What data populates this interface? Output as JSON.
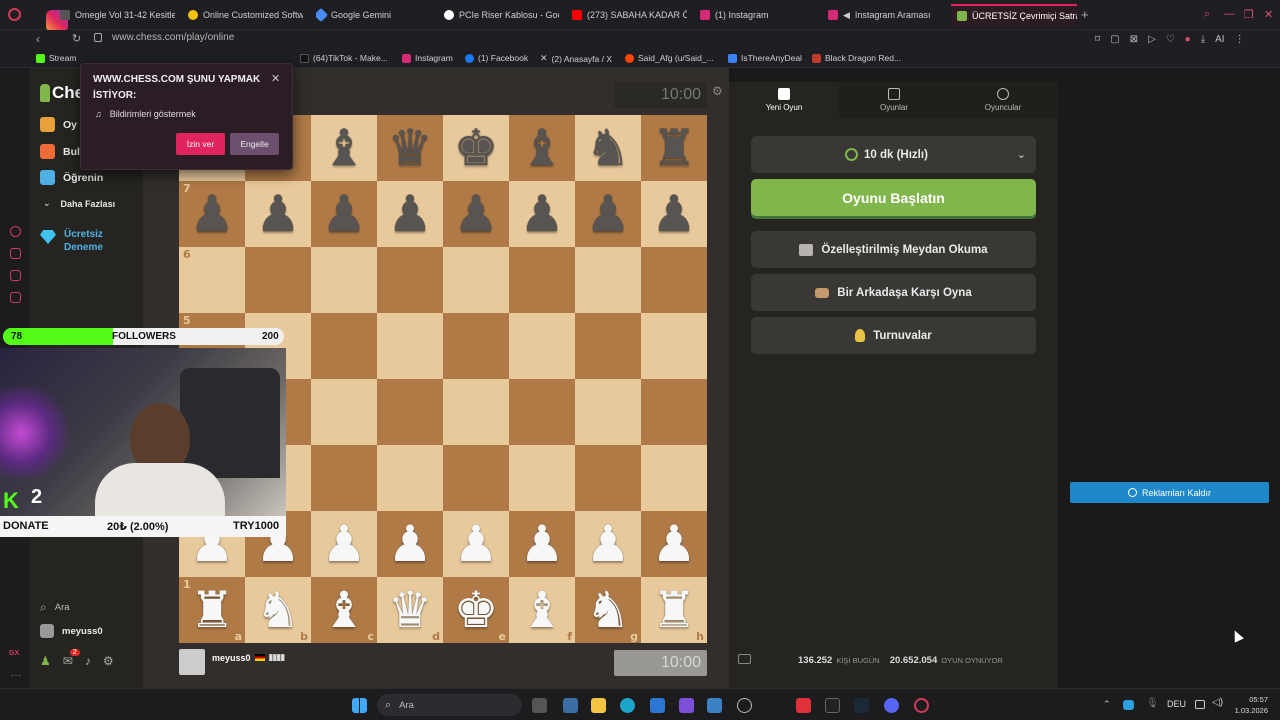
{
  "browser": {
    "tabs": [
      {
        "label": "Omegle Vol 31-42 Kesitler",
        "color": "#555"
      },
      {
        "label": "Online Customized Softwa",
        "color": "#f4c20d"
      },
      {
        "label": "Google Gemini",
        "color": "#4a8cf7"
      },
      {
        "label": "PCIe Riser Kablosu - Goog",
        "color": "#ffffff"
      },
      {
        "label": "(273) SABAHA KADAR ÖV",
        "color": "#ff0000"
      },
      {
        "label": "(1) Instagram",
        "color": "#d62976"
      },
      {
        "label": "Instagram Araması",
        "color": "#d62976"
      },
      {
        "label": "ÜCRETSİZ Çevrimiçi Satra",
        "color": "#81b64c"
      }
    ],
    "url": "www.chess.com/play/online",
    "bookmarks": [
      {
        "label": "Stream",
        "color": "#53fc18"
      },
      {
        "label": "(64)TikTok - Make...",
        "color": "#111"
      },
      {
        "label": "Instagram",
        "color": "#d62976"
      },
      {
        "label": "(1) Facebook",
        "color": "#1877f2"
      },
      {
        "label": "(2) Anasayfa / X",
        "color": "#000"
      },
      {
        "label": "Said_Afg (u/Said_...",
        "color": "#ff4500"
      },
      {
        "label": "IsThereAnyDeal",
        "color": "#3b82f6"
      },
      {
        "label": "Black Dragon Red...",
        "color": "#c0392b"
      }
    ]
  },
  "permission_popup": {
    "title": "WWW.CHESS.COM ŞUNU YAPMAK İSTİYOR:",
    "item": "Bildirimleri göstermek",
    "allow_label": "İzin ver",
    "block_label": "Engelle"
  },
  "sidebar": {
    "logo": "Ches",
    "items": [
      {
        "label": "Oy",
        "color": "#e9a23b"
      },
      {
        "label": "Bul",
        "color": "#ef6b3a"
      },
      {
        "label": "Öğrenin",
        "color": "#4fb0e6"
      }
    ],
    "more_label": "Daha Fazlası",
    "trial_label_1": "Ücretsiz",
    "trial_label_2": "Deneme",
    "search_label": "Ara",
    "user_label": "meyuss0",
    "notification_count": "2"
  },
  "board": {
    "top_clock": "10:00",
    "bottom_clock": "10:00",
    "player_name": "meyuss0",
    "ranks_labels": [
      "7",
      "6",
      "5",
      "1"
    ],
    "files_labels": [
      "a",
      "b",
      "c",
      "d",
      "e",
      "f",
      "g",
      "h"
    ],
    "position": [
      [
        "♜",
        "♞",
        "♝",
        "♛",
        "♚",
        "♝",
        "♞",
        "♜"
      ],
      [
        "♟",
        "♟",
        "♟",
        "♟",
        "♟",
        "♟",
        "♟",
        "♟"
      ],
      [
        "",
        "",
        "",
        "",
        "",
        "",
        "",
        ""
      ],
      [
        "",
        "",
        "",
        "",
        "",
        "",
        "",
        ""
      ],
      [
        "",
        "",
        "",
        "",
        "",
        "",
        "",
        ""
      ],
      [
        "",
        "",
        "",
        "",
        "",
        "",
        "",
        ""
      ],
      [
        "♟",
        "♟",
        "♟",
        "♟",
        "♟",
        "♟",
        "♟",
        "♟"
      ],
      [
        "♜",
        "♞",
        "♝",
        "♛",
        "♚",
        "♝",
        "♞",
        "♜"
      ]
    ]
  },
  "panel": {
    "tabs": [
      "Yeni Oyun",
      "Oyunlar",
      "Oyuncular"
    ],
    "time_control": "10 dk (Hızlı)",
    "start_button": "Oyunu Başlatın",
    "buttons": [
      "Özelleştirilmiş Meydan Okuma",
      "Bir Arkadaşa Karşı Oyna",
      "Turnuvalar"
    ],
    "players_today": "136.252",
    "players_today_label": "KİŞİ BUGÜN",
    "playing_now": "20.652.054",
    "playing_now_label": "OYUN OYNUYOR"
  },
  "ads_button": "Reklamları Kaldır",
  "overlay": {
    "followers_current": "78",
    "followers_label": "FOLLOWERS",
    "followers_goal": "200",
    "followers_progress": 0.39,
    "kick_count": "2",
    "donate_label": "DONATE",
    "donate_amount": "20₺ (2.00%)",
    "donate_goal": "TRY1000"
  },
  "taskbar": {
    "search_label": "Ara",
    "language": "DEU",
    "time": "05:57",
    "date": "1.03.2026"
  }
}
